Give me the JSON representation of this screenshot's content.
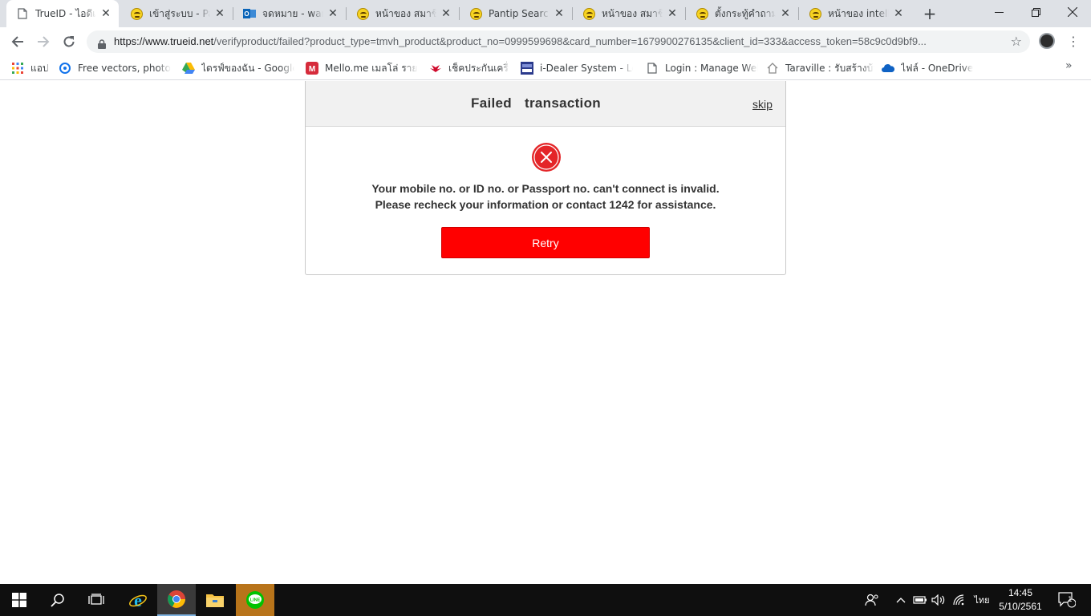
{
  "browser": {
    "tabs": [
      {
        "title": "TrueID - ไอดีเดียว",
        "icon": "page-icon",
        "active": true
      },
      {
        "title": "เข้าสู่ระบบ - Pantip",
        "icon": "pantip-emoji-icon",
        "active": false
      },
      {
        "title": "จดหมาย - wanaporn",
        "icon": "outlook-icon",
        "active": false
      },
      {
        "title": "หน้าของ สมาชิก",
        "icon": "pantip-emoji-icon",
        "active": false
      },
      {
        "title": "Pantip Search",
        "icon": "pantip-emoji-icon",
        "active": false
      },
      {
        "title": "หน้าของ สมาชิก",
        "icon": "pantip-emoji-icon",
        "active": false
      },
      {
        "title": "ตั้งกระทู้คำถาม",
        "icon": "pantip-emoji-icon",
        "active": false
      },
      {
        "title": "หน้าของ intelligence",
        "icon": "pantip-emoji-icon",
        "active": false
      }
    ],
    "new_tab_label": "+",
    "url_host": "https://www.trueid.net",
    "url_rest": "/verifyproduct/failed?product_type=tmvh_product&product_no=0999599698&card_number=1679900276135&client_id=333&access_token=58c9c0d9bf9...",
    "bookmarks": [
      {
        "label": "แอป",
        "icon": "apps-grid-icon"
      },
      {
        "label": "Free vectors, photos",
        "icon": "freepik-icon"
      },
      {
        "label": "ไดรฟ์ของฉัน - Google",
        "icon": "google-drive-icon"
      },
      {
        "label": "Mello.me เมลโล่ รายการ",
        "icon": "mello-icon"
      },
      {
        "label": "เช็คประกันเครื่อง",
        "icon": "huawei-icon"
      },
      {
        "label": "i-Dealer System - Log",
        "icon": "idealer-icon"
      },
      {
        "label": "Login : Manage Web",
        "icon": "page-icon"
      },
      {
        "label": "Taraville : รับสร้างบ้าน",
        "icon": "house-icon"
      },
      {
        "label": "ไฟล์ - OneDrive",
        "icon": "onedrive-icon"
      }
    ],
    "bookmarks_more": "»"
  },
  "dialog": {
    "title": "Failed  transaction",
    "skip_label": "skip",
    "message_line1": "Your mobile no. or ID no. or Passport no. can't connect is invalid.",
    "message_line2": "Please recheck your information or contact 1242 for assistance.",
    "retry_label": "Retry",
    "error_icon": "error-x-icon"
  },
  "taskbar": {
    "language": "ไทย",
    "time": "14:45",
    "date": "5/10/2561",
    "notification_count": "1"
  },
  "colors": {
    "retry_bg": "#ff0000",
    "error_icon_bg": "#e42528",
    "header_bg": "#f1f1f1"
  }
}
